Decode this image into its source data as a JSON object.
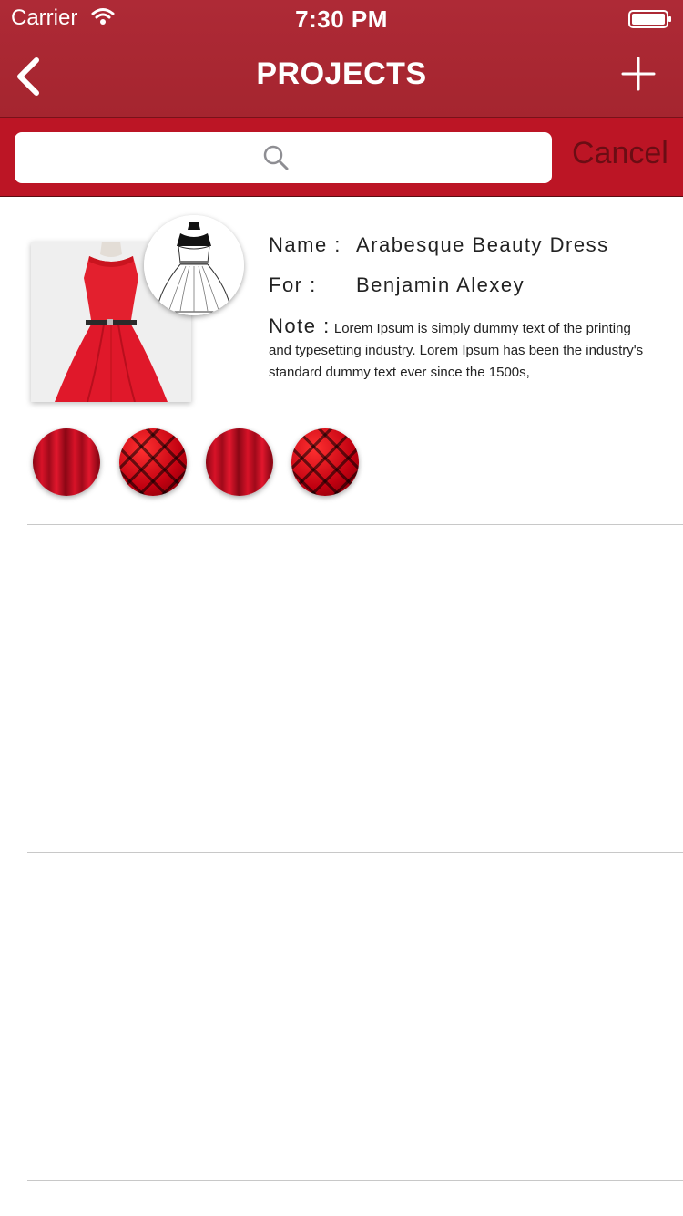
{
  "status_bar": {
    "carrier": "Carrier",
    "time": "7:30 PM",
    "icons": [
      "wifi-icon",
      "battery-icon"
    ]
  },
  "nav": {
    "title": "PROJECTS",
    "back_icon": "chevron-left-icon",
    "add_icon": "plus-icon"
  },
  "search": {
    "placeholder": "",
    "icon": "search-icon",
    "cancel_label": "Cancel"
  },
  "projects": [
    {
      "name_label": "Name :",
      "name": "Arabesque Beauty Dress",
      "for_label": "For :",
      "for": "Benjamin Alexey",
      "note_label": "Note :",
      "note": "Lorem Ipsum is simply dummy text of the printing and typesetting industry. Lorem Ipsum has been the industry's standard dummy text ever since the 1500s,",
      "swatches": [
        "red-drape-fabric",
        "red-quilted-fabric",
        "red-drape-fabric",
        "red-quilted-fabric"
      ]
    }
  ],
  "colors": {
    "nav_bar": "#ab2833",
    "search_bar": "#bc1525",
    "cancel_text": "#6b0d14",
    "divider": "#c8c8c8"
  }
}
